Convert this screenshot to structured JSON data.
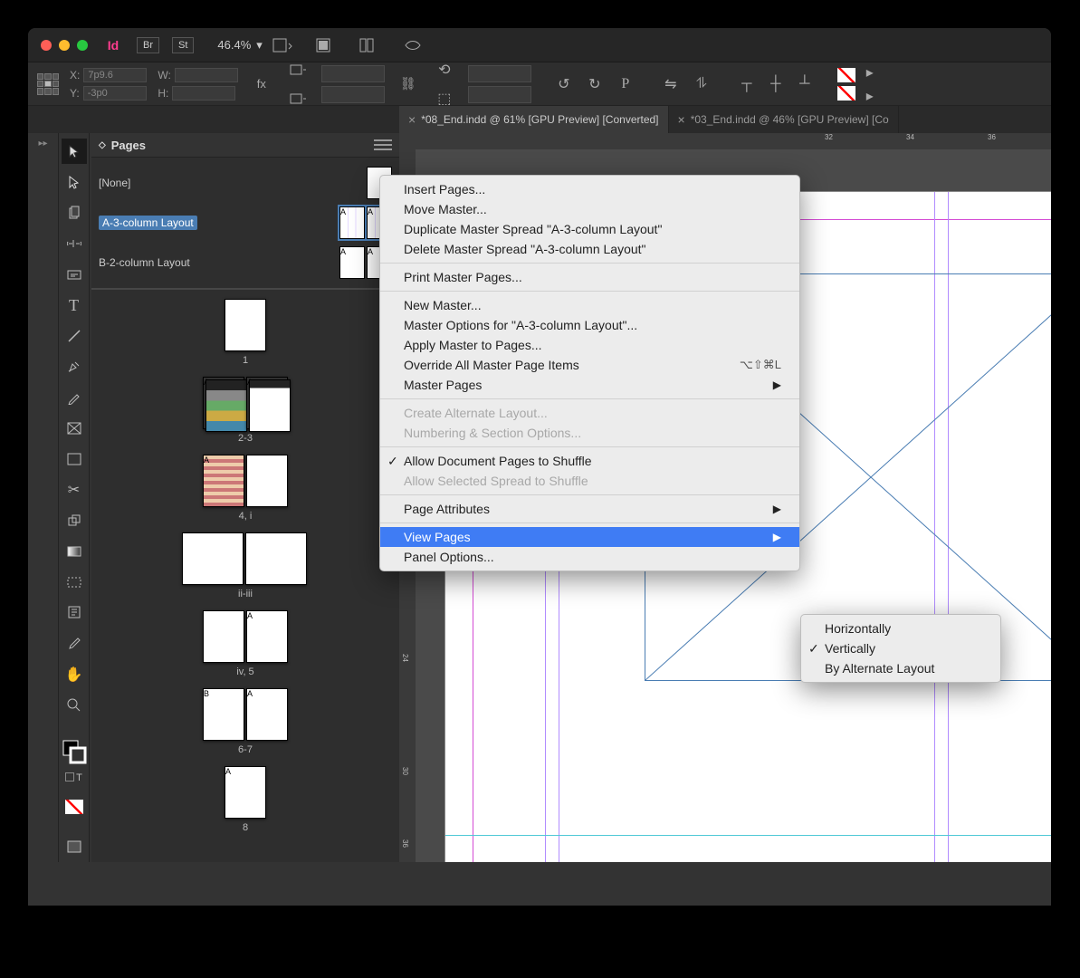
{
  "app": {
    "title": "Adobe InDesign",
    "br": "Br",
    "st": "St",
    "zoom": "46.4%"
  },
  "control": {
    "x_label": "X:",
    "y_label": "Y:",
    "w_label": "W:",
    "h_label": "H:",
    "x_val": "7p9.6",
    "y_val": "-3p0",
    "w_val": "",
    "h_val": ""
  },
  "tabs": [
    {
      "close": "×",
      "label": "*08_End.indd @ 61% [GPU Preview] [Converted]"
    },
    {
      "close": "×",
      "label": "*03_End.indd @ 46% [GPU Preview] [Co"
    }
  ],
  "pages_panel": {
    "title": "Pages",
    "masters": [
      {
        "label": "[None]"
      },
      {
        "label": "A-3-column Layout",
        "sel": true
      },
      {
        "label": "B-2-column Layout"
      }
    ],
    "pages": [
      {
        "label": "1",
        "spread": false
      },
      {
        "label": "2-3",
        "spread": true
      },
      {
        "label": "4, i",
        "spread": true
      },
      {
        "label": "ii-iii",
        "spread": true
      },
      {
        "label": "iv, 5",
        "spread": true
      },
      {
        "label": "6-7",
        "spread": true
      },
      {
        "label": "8",
        "spread": false
      }
    ]
  },
  "ruler_marks": [
    "32",
    "34",
    "36"
  ],
  "ruler_v": [
    "24",
    "30",
    "36"
  ],
  "context_menu": {
    "items": [
      {
        "label": "Insert Pages..."
      },
      {
        "label": "Move Master..."
      },
      {
        "label": "Duplicate Master Spread \"A-3-column Layout\""
      },
      {
        "label": "Delete Master Spread \"A-3-column Layout\""
      },
      {
        "sep": true
      },
      {
        "label": "Print Master Pages..."
      },
      {
        "sep": true
      },
      {
        "label": "New Master..."
      },
      {
        "label": "Master Options for \"A-3-column Layout\"..."
      },
      {
        "label": "Apply Master to Pages..."
      },
      {
        "label": "Override All Master Page Items",
        "shortcut": "⌥⇧⌘L"
      },
      {
        "label": "Master Pages",
        "submenu": true
      },
      {
        "sep": true
      },
      {
        "label": "Create Alternate Layout...",
        "dis": true
      },
      {
        "label": "Numbering & Section Options...",
        "dis": true
      },
      {
        "sep": true
      },
      {
        "label": "Allow Document Pages to Shuffle",
        "checked": true
      },
      {
        "label": "Allow Selected Spread to Shuffle",
        "dis": true
      },
      {
        "sep": true
      },
      {
        "label": "Page Attributes",
        "submenu": true
      },
      {
        "sep": true
      },
      {
        "label": "View Pages",
        "submenu": true,
        "hilite": true
      },
      {
        "label": "Panel Options..."
      }
    ]
  },
  "submenu": {
    "items": [
      {
        "label": "Horizontally"
      },
      {
        "label": "Vertically",
        "checked": true
      },
      {
        "label": "By Alternate Layout"
      }
    ]
  }
}
